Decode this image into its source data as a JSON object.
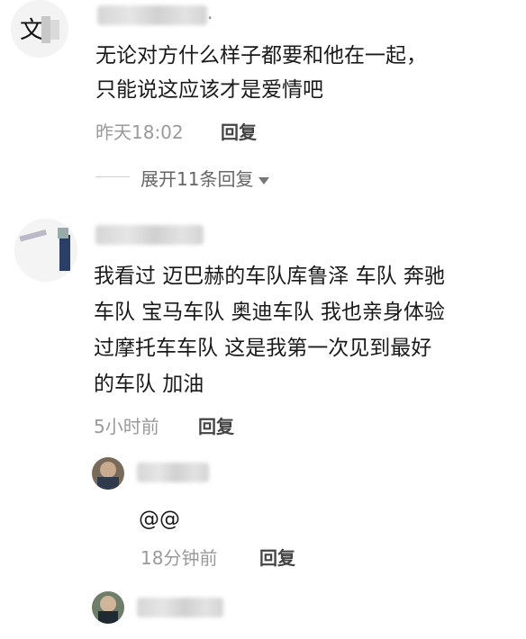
{
  "comments": [
    {
      "text_line1": "无论对方什么样子都要和他在一起，",
      "text_line2": "只能说这应该才是爱情吧",
      "time": "昨天18:02",
      "reply_label": "回复",
      "expand_label": "展开11条回复"
    },
    {
      "text_line1": "我看过 迈巴赫的车队库鲁泽 车队 奔驰",
      "text_line2": "车队 宝马车队 奥迪车队 我也亲身体验",
      "text_line3": "过摩托车车队 这是我第一次见到最好",
      "text_line4": "的车队 加油",
      "time": "5小时前",
      "reply_label": "回复",
      "replies": [
        {
          "text": "@@",
          "time": "18分钟前",
          "reply_label": "回复"
        }
      ]
    }
  ]
}
